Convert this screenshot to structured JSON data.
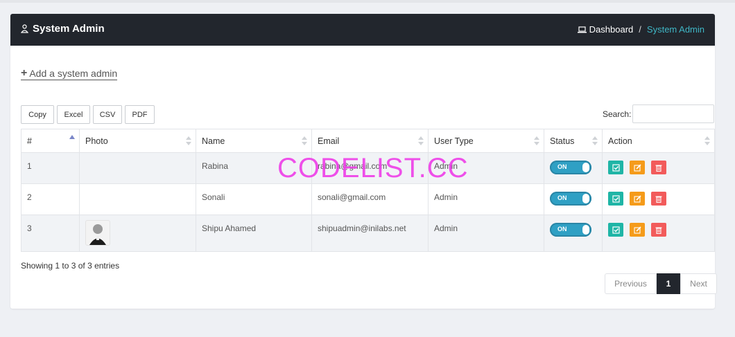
{
  "header": {
    "title": "System Admin",
    "icon": "user-icon"
  },
  "breadcrumb": {
    "home": "Dashboard",
    "separator": "/",
    "current": "System Admin",
    "current_color": "#3fb7c6"
  },
  "add_link": {
    "label": "Add a system admin"
  },
  "export_buttons": [
    "Copy",
    "Excel",
    "CSV",
    "PDF"
  ],
  "search": {
    "label": "Search:",
    "value": "",
    "placeholder": ""
  },
  "table": {
    "columns": [
      "#",
      "Photo",
      "Name",
      "Email",
      "User Type",
      "Status",
      "Action"
    ],
    "rows": [
      {
        "num": "1",
        "name": "Rabina",
        "email": "rabina@gmail.com",
        "type": "Admin",
        "status": "ON",
        "has_photo": false
      },
      {
        "num": "2",
        "name": "Sonali",
        "email": "sonali@gmail.com",
        "type": "Admin",
        "status": "ON",
        "has_photo": false
      },
      {
        "num": "3",
        "name": "Shipu Ahamed",
        "email": "shipuadmin@inilabs.net",
        "type": "Admin",
        "status": "ON",
        "has_photo": true
      }
    ]
  },
  "footer": {
    "info": "Showing 1 to 3 of 3 entries"
  },
  "pagination": {
    "previous": "Previous",
    "current": "1",
    "next": "Next"
  },
  "watermark": "CODELIST.CC",
  "colors": {
    "header_bg": "#22262d",
    "toggle_on": "#2fa0c4",
    "view": "#1fb5a6",
    "edit": "#f59b1a",
    "delete": "#f25b5b"
  }
}
